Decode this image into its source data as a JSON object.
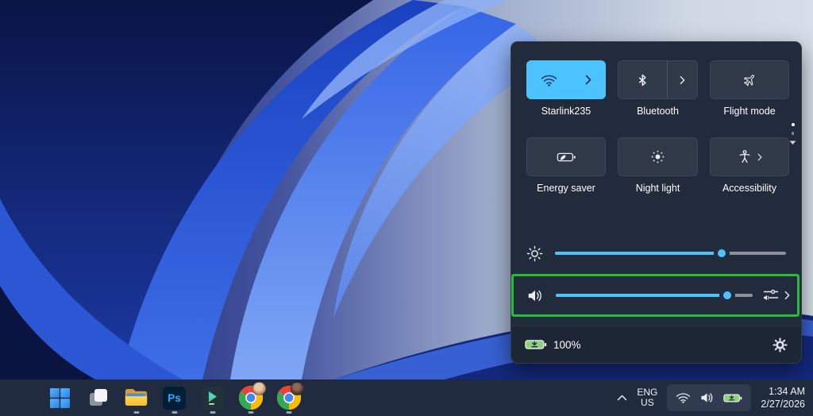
{
  "quick_settings": {
    "accent_color": "#4cc2ff",
    "highlight_color": "#23bd36",
    "tiles": [
      {
        "label": "Starlink235",
        "icon": "wifi-icon",
        "active": true,
        "has_chevron": true
      },
      {
        "label": "Bluetooth",
        "icon": "bluetooth-icon",
        "active": false,
        "has_chevron": true
      },
      {
        "label": "Flight mode",
        "icon": "airplane-icon",
        "active": false,
        "has_chevron": false
      },
      {
        "label": "Energy saver",
        "icon": "battery-leaf-icon",
        "active": false,
        "has_chevron": false
      },
      {
        "label": "Night light",
        "icon": "night-light-sun-icon",
        "active": false,
        "has_chevron": false
      },
      {
        "label": "Accessibility",
        "icon": "accessibility-person-icon",
        "active": false,
        "has_chevron": true
      }
    ],
    "page_indicator": {
      "dots": 2,
      "current_page": 1,
      "down_arrow": true
    },
    "brightness": {
      "percent": 72,
      "icon": "brightness-sun-icon"
    },
    "volume": {
      "percent": 87,
      "icon": "speaker-icon",
      "output_icon": "audio-output-mixer-icon",
      "chevron_icon": "chevron-right-icon"
    },
    "battery_status": {
      "label": "100%",
      "charging": true,
      "icon": "battery-charging-icon"
    },
    "settings_icon": "gear-icon",
    "annotation": {
      "shape": "green-rectangle",
      "target": "volume-slider-row",
      "color": "#23bd36"
    }
  },
  "taskbar": {
    "items": [
      {
        "name": "start",
        "icon": "windows-start-icon",
        "running": false
      },
      {
        "name": "task-view",
        "icon": "task-view-icon",
        "running": false
      },
      {
        "name": "file-explorer",
        "icon": "folder-icon",
        "running": true
      },
      {
        "name": "photoshop",
        "icon": "photoshop-ps-icon",
        "running": true
      },
      {
        "name": "filmora",
        "icon": "filmora-play-icon",
        "running": true
      },
      {
        "name": "chrome-profile-1",
        "icon": "chrome-icon",
        "running": true,
        "avatar_color": "#cfa386"
      },
      {
        "name": "chrome-profile-2",
        "icon": "chrome-icon",
        "running": true,
        "avatar_color": "#53392e"
      }
    ],
    "photoshop_label": "Ps",
    "tray": {
      "chevron": "chevron-up-icon",
      "language_line1": "ENG",
      "language_line2": "US",
      "icons": [
        "wifi-icon",
        "speaker-icon",
        "battery-charging-icon"
      ],
      "time": "1:34 AM",
      "date": "2/27/2026"
    }
  }
}
